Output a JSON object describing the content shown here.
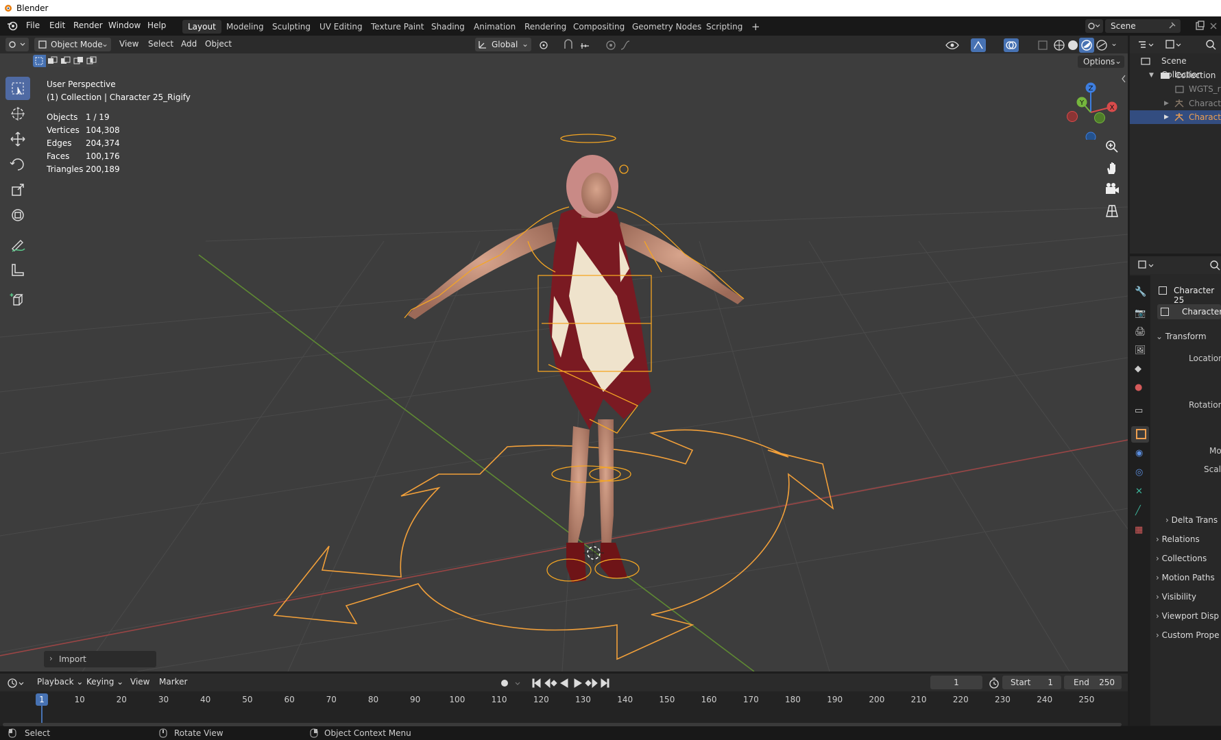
{
  "os_window": {
    "title": "Blender"
  },
  "topbar": {
    "menus": [
      "File",
      "Edit",
      "Render",
      "Window",
      "Help"
    ],
    "workspaces": [
      "Layout",
      "Modeling",
      "Sculpting",
      "UV Editing",
      "Texture Paint",
      "Shading",
      "Animation",
      "Rendering",
      "Compositing",
      "Geometry Nodes",
      "Scripting"
    ],
    "active_workspace": "Layout",
    "add_workspace": "+",
    "scene": "Scene"
  },
  "viewport_header": {
    "mode": "Object Mode",
    "menus": [
      "View",
      "Select",
      "Add",
      "Object"
    ],
    "orientation": "Global",
    "options_label": "Options"
  },
  "overlay": {
    "perspective": "User Perspective",
    "collection_line": "(1) Collection | Character 25_Rigify",
    "stats": [
      {
        "label": "Objects",
        "value": "1 / 19"
      },
      {
        "label": "Vertices",
        "value": "104,308"
      },
      {
        "label": "Edges",
        "value": "204,374"
      },
      {
        "label": "Faces",
        "value": "100,176"
      },
      {
        "label": "Triangles",
        "value": "200,189"
      }
    ]
  },
  "gizmo": {
    "x": "X",
    "y": "Y",
    "z": "Z"
  },
  "last_operator": "Import",
  "outliner": {
    "items": [
      {
        "label": "Scene Collection"
      },
      {
        "label": "Collection"
      },
      {
        "label": "WGTS_ri"
      },
      {
        "label": "Characte"
      },
      {
        "label": "Characte"
      }
    ]
  },
  "properties": {
    "object_name": "Character 25",
    "data_name": "Character",
    "transform_label": "Transform",
    "location_label": "Location",
    "rotation_label": "Rotation",
    "mode_label": "Mo",
    "scale_label": "Scale",
    "sections": [
      "Delta Trans",
      "Relations",
      "Collections",
      "Motion Paths",
      "Visibility",
      "Viewport Disp",
      "Custom Prope"
    ]
  },
  "timeline": {
    "menus": [
      "Playback",
      "Keying",
      "View",
      "Marker"
    ],
    "current_frame": "1",
    "start_label": "Start",
    "start_value": "1",
    "end_label": "End",
    "end_value": "250",
    "ticks": [
      "1",
      "10",
      "20",
      "30",
      "40",
      "50",
      "60",
      "70",
      "80",
      "90",
      "100",
      "110",
      "120",
      "130",
      "140",
      "150",
      "160",
      "170",
      "180",
      "190",
      "200",
      "210",
      "220",
      "230",
      "240",
      "250"
    ]
  },
  "statusbar": {
    "items": [
      "Select",
      "Rotate View",
      "Object Context Menu"
    ]
  },
  "colors": {
    "accent": "#4772b3",
    "rig": "#f5a623",
    "x_axis": "#b44444",
    "y_axis": "#6b9a3b"
  }
}
